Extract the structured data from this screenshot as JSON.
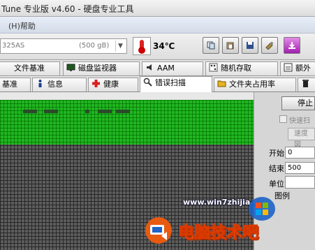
{
  "window": {
    "title": "Tune 专业版 v4.60 - 硬盘专业工具"
  },
  "menu": {
    "help": "(H)帮助"
  },
  "toolbar": {
    "drive_model": "325AS",
    "drive_capacity": "(500 gB)",
    "temperature": "34℃",
    "buttons": [
      "copy-icon",
      "paste-icon",
      "save-icon",
      "tools-icon",
      "exit-icon"
    ]
  },
  "tabs_row1": [
    {
      "label": "文件基准",
      "icon": "file-icon"
    },
    {
      "label": "磁盘监视器",
      "icon": "monitor-icon"
    },
    {
      "label": "AAM",
      "icon": "speaker-icon"
    },
    {
      "label": "随机存取",
      "icon": "random-access-icon"
    },
    {
      "label": "额外",
      "icon": "extra-icon"
    }
  ],
  "tabs_row2": [
    {
      "label": "基准",
      "icon": ""
    },
    {
      "label": "信息",
      "icon": "info-icon"
    },
    {
      "label": "健康",
      "icon": "health-icon"
    },
    {
      "label": "错误扫描",
      "icon": "magnifier-icon",
      "active": true
    },
    {
      "label": "文件夹占用率",
      "icon": "folder-icon"
    },
    {
      "label": "",
      "icon": "trash-icon"
    }
  ],
  "panel": {
    "stop": "停止",
    "quick_scan": "快速扫",
    "speed_btn": "速度図",
    "start_label": "开始",
    "start_value": "0",
    "end_label": "结束",
    "end_value": "500",
    "unit_label": "单位",
    "legend_label": "图例"
  },
  "scan": {
    "scanned_fraction": 0.3
  },
  "watermark": {
    "url": "www.win7zhijia.cn",
    "brand": "电脑技术吧"
  },
  "colors": {
    "ok_block": "#22b622",
    "pending_block": "#5d5d5d",
    "bad_block": "#2a4a2a"
  }
}
